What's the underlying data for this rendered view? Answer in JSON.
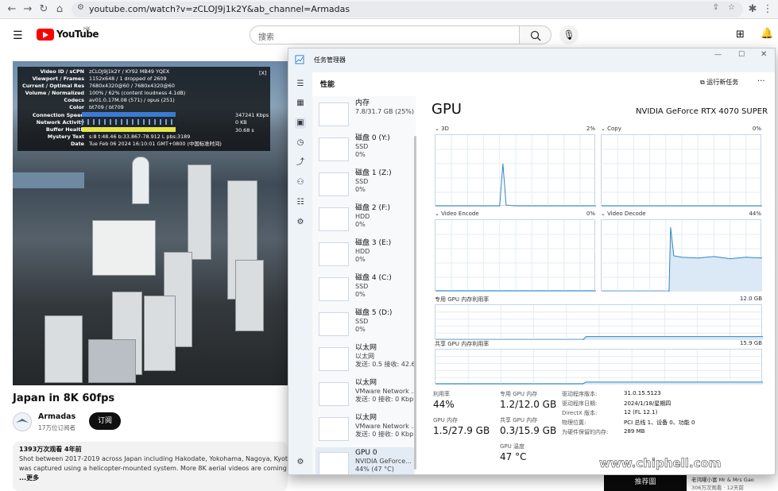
{
  "browser": {
    "url": "youtube.com/watch?v=zCLOJ9j1k2Y&ab_channel=Armadas"
  },
  "youtube": {
    "logo_text": "YouTube",
    "logo_region": "HK",
    "search_placeholder": "搜索",
    "video_title": "Japan in 8K 60fps",
    "channel_name": "Armadas",
    "subscribers": "17万位订阅者",
    "subscribe_label": "订阅",
    "views_date": "1393万次观看  4年前",
    "desc_line1": "Shot between 2017-2019 across Japan including Hakodate, Yokohama, Nagoya, Kyoto,",
    "desc_line2": "was captured using a helicopter-mounted system. More 8K aerial videos are coming so",
    "desc_more": "...更多",
    "rec_label": "推荐圖",
    "rec_info1": "老鸿曜小富 Mr & Mrs Gao",
    "rec_info2": "306万次观看 · 12天前",
    "stats": [
      {
        "k": "Video ID / sCPN",
        "v": "zCLOJ9j1k2Y  /  KY92  MB49  YQEX"
      },
      {
        "k": "Viewport / Frames",
        "v": "1152x648 / 1 dropped of 2609"
      },
      {
        "k": "Current / Optimal Res",
        "v": "7680x4320@60 / 7680x4320@60"
      },
      {
        "k": "Volume / Normalized",
        "v": "100% / 62% (content loudness 4.1dB)"
      },
      {
        "k": "Codecs",
        "v": "av01.0.17M.08 (571) / opus (251)"
      },
      {
        "k": "Color",
        "v": "bt709 / bt709"
      },
      {
        "k": "Connection Speed",
        "v": ""
      },
      {
        "k": "Network Activity",
        "v": ""
      },
      {
        "k": "Buffer Health",
        "v": ""
      },
      {
        "k": "Mystery Text",
        "v": "s:8 t:48.46 b:33.867-78.912 L pbs:3189"
      },
      {
        "k": "Date",
        "v": "Tue Feb 06 2024 16:10:01 GMT+0800 (中国标准时间)"
      }
    ],
    "stats_right": {
      "speed": "347241 Kbps",
      "net": "0 KB",
      "buffer": "30.68 s"
    },
    "stats_close": "[X]"
  },
  "taskmgr": {
    "title": "任务管理器",
    "tab": "性能",
    "run_task": "运行新任务",
    "more": "···",
    "list": [
      {
        "name": "内存",
        "l2": "7.8/31.7 GB (25%)",
        "l3": ""
      },
      {
        "name": "磁盘 0 (Y:)",
        "l2": "SSD",
        "l3": "0%"
      },
      {
        "name": "磁盘 1 (Z:)",
        "l2": "SSD",
        "l3": "0%"
      },
      {
        "name": "磁盘 2 (F:)",
        "l2": "HDD",
        "l3": "0%"
      },
      {
        "name": "磁盘 3 (E:)",
        "l2": "HDD",
        "l3": "0%"
      },
      {
        "name": "磁盘 4 (C:)",
        "l2": "SSD",
        "l3": "0%"
      },
      {
        "name": "磁盘 5 (D:)",
        "l2": "SSD",
        "l3": "0%"
      },
      {
        "name": "以太网",
        "l2": "以太网",
        "l3": "发送: 0.5  接收: 42.6"
      },
      {
        "name": "以太网",
        "l2": "VMware Network ...",
        "l3": "发送: 0  接收: 0 Kbp"
      },
      {
        "name": "以太网",
        "l2": "VMware Network ...",
        "l3": "发送: 0  接收: 0 Kbp"
      },
      {
        "name": "GPU 0",
        "l2": "NVIDIA GeForce...",
        "l3": "44% (47 °C)"
      }
    ],
    "gpu_heading": "GPU",
    "gpu_model": "NVIDIA GeForce RTX 4070 SUPER",
    "charts": {
      "c3d": {
        "label": "3D",
        "pct": "2%"
      },
      "copy": {
        "label": "Copy",
        "pct": "0%"
      },
      "venc": {
        "label": "Video Encode",
        "pct": "0%"
      },
      "vdec": {
        "label": "Video Decode",
        "pct": "44%"
      },
      "dedicated": {
        "label": "专用 GPU 内存利用率",
        "max": "12.0 GB"
      },
      "shared": {
        "label": "共享 GPU 内存利用率",
        "max": "15.9 GB"
      }
    },
    "metrics": {
      "util_label": "利用率",
      "util": "44%",
      "ded_label": "专用 GPU 内存",
      "ded": "1.2/12.0 GB",
      "gmem_label": "GPU 内存",
      "gmem": "1.5/27.9 GB",
      "shr_label": "共享 GPU 内存",
      "shr": "0.3/15.9 GB",
      "temp_label": "GPU 温度",
      "temp": "47 °C"
    },
    "details": [
      {
        "k": "驱动程序版本:",
        "v": "31.0.15.5123"
      },
      {
        "k": "驱动程序日期:",
        "v": "2024/1/18/星期四"
      },
      {
        "k": "DirectX 版本:",
        "v": "12 (FL 12.1)"
      },
      {
        "k": "物理位置:",
        "v": "PCI 总线 1、设备 0、功能 0"
      },
      {
        "k": "为硬件保留的内存:",
        "v": "289 MB"
      }
    ]
  },
  "watermark": {
    "text": "www.chiphell.com",
    "logo": "chip hell"
  }
}
